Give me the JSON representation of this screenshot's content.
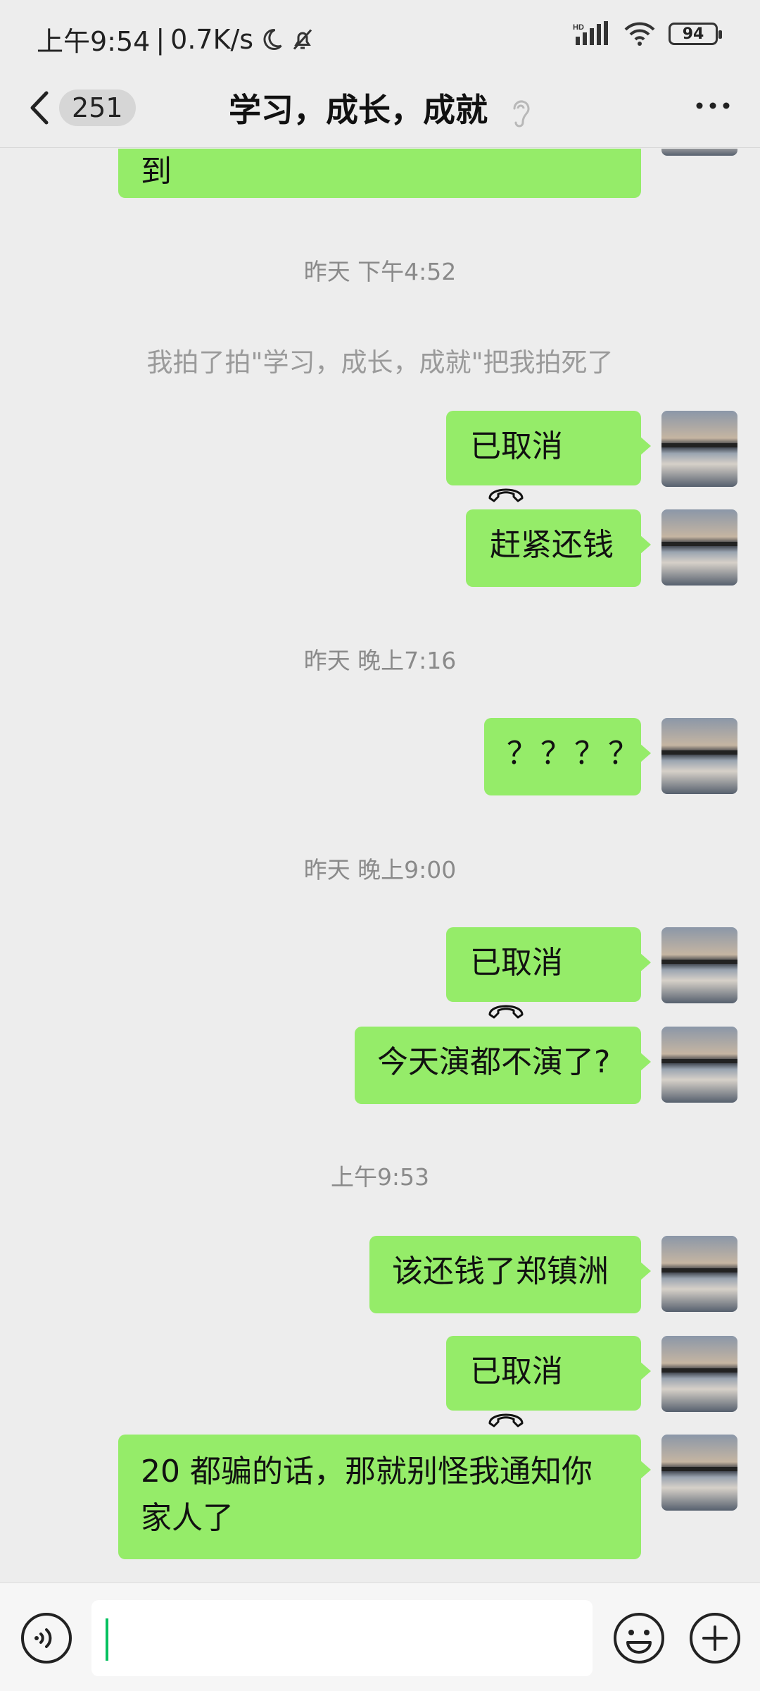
{
  "status_bar": {
    "time": "上午9:54",
    "separator": "|",
    "speed": "0.7K/s",
    "network": "HD",
    "battery": "94"
  },
  "nav": {
    "unread_count": "251",
    "title": "学习，成长，成就"
  },
  "messages": {
    "m0": "到",
    "ts1": "昨天 下午4:52",
    "sys1": "我拍了拍\"学习，成长，成就\"把我拍死了",
    "m1": "已取消",
    "m2": "赶紧还钱",
    "ts2": "昨天 晚上7:16",
    "m3": "？？？？",
    "ts3": "昨天 晚上9:00",
    "m4": "已取消",
    "m5": "今天演都不演了?",
    "ts4": "上午9:53",
    "m6": "该还钱了郑镇洲",
    "m7": "已取消",
    "m8_line1": "20 都骗的话，那就别怪我通知你",
    "m8_line2": "家人了"
  },
  "icons": {
    "back": "chevron-left-icon",
    "ear": "ear-icon",
    "more": "more-icon",
    "call": "phone-hangup-icon",
    "voice": "voice-icon",
    "emoji": "emoji-icon",
    "plus": "plus-icon"
  },
  "colors": {
    "bubble": "#95ec69",
    "background": "#ededed",
    "caret": "#07c160"
  }
}
